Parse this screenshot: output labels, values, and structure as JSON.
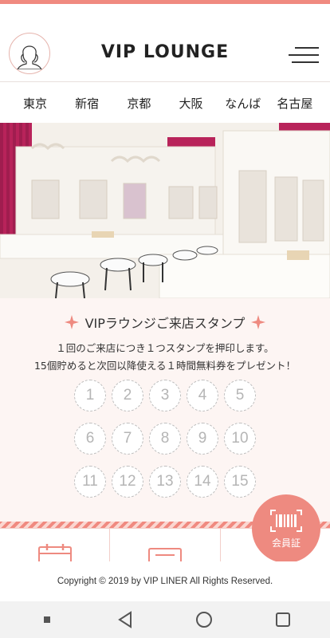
{
  "header": {
    "logo": "VIP LOUNGE"
  },
  "nav": [
    {
      "label": "東京"
    },
    {
      "label": "新宿"
    },
    {
      "label": "京都"
    },
    {
      "label": "大阪"
    },
    {
      "label": "なんば"
    },
    {
      "label": "名古屋"
    }
  ],
  "stamp": {
    "title": "VIPラウンジご来店スタンプ",
    "desc_line1": "１回のご来店につき１つスタンプを押印します。",
    "desc_line2": "15個貯めると次回以降使える１時間無料券をプレゼント！",
    "numbers": [
      "1",
      "2",
      "3",
      "4",
      "5",
      "6",
      "7",
      "8",
      "9",
      "10",
      "11",
      "12",
      "13",
      "14",
      "15"
    ]
  },
  "member_button": {
    "label": "会員証"
  },
  "footer": {
    "copyright": "Copyright © 2019 by VIP LINER All Rights Reserved."
  },
  "colors": {
    "accent": "#ee8a80",
    "stripe": "#f08a80",
    "bg_soft": "#fdf5f3"
  }
}
